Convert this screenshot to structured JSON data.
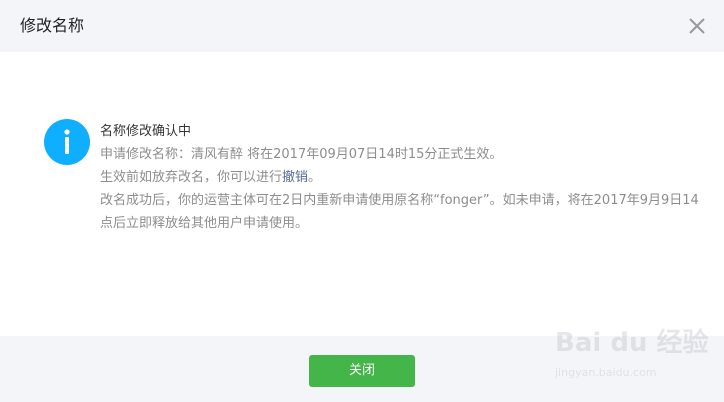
{
  "dialog": {
    "title": "修改名称",
    "close_icon": "close-icon"
  },
  "message": {
    "icon": "info-icon",
    "icon_color": "#10aeff",
    "heading": "名称修改确认中",
    "line1": "申请修改名称：清风有醉 将在2017年09月07日14时15分正式生效。",
    "line2_prefix": "生效前如放弃改名，你可以进行",
    "line2_link": "撤销",
    "line2_suffix": "。",
    "line3": "改名成功后，你的运营主体可在2日内重新申请使用原名称“fonger”。如未申请，将在2017年9月9日14点后立即释放给其他用户申请使用。"
  },
  "footer": {
    "close_label": "关闭",
    "button_color": "#44b549"
  },
  "watermark": {
    "brand": "Bai du 经验",
    "url": "jingyan.baidu.com"
  }
}
